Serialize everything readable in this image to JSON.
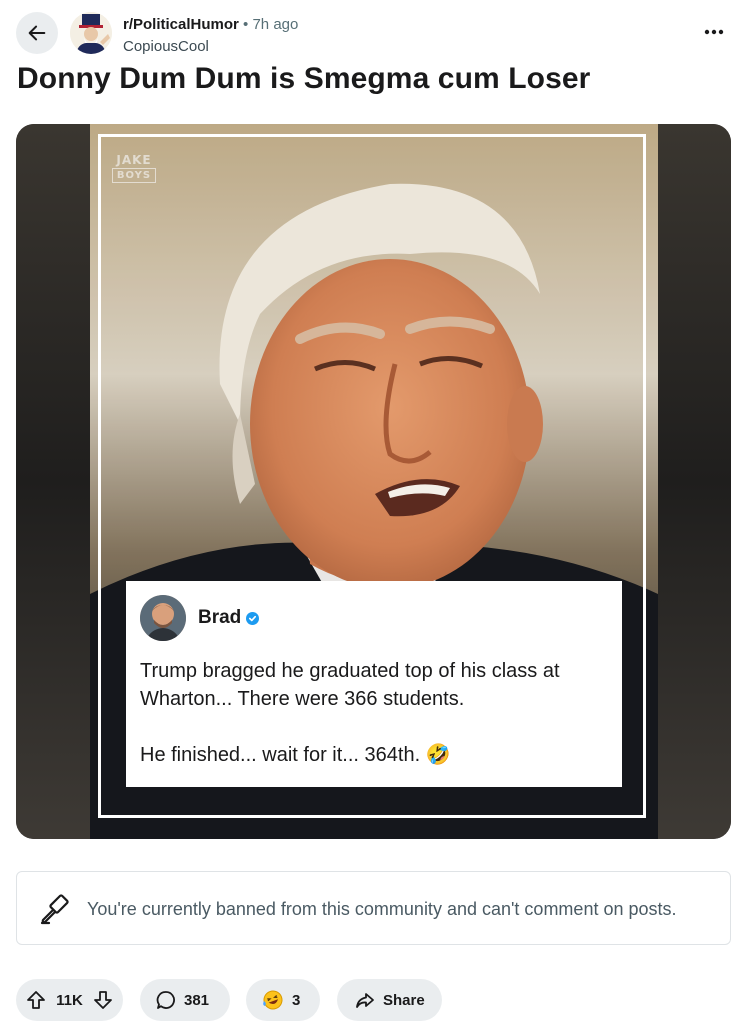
{
  "post": {
    "subreddit": "r/PoliticalHumor",
    "separator": "•",
    "time_ago": "7h ago",
    "author": "CopiousCool",
    "title": "Donny Dum Dum is Smegma cum Loser"
  },
  "image": {
    "watermark_line1": "JAKE",
    "watermark_line2": "BOYS",
    "tweet": {
      "name": "Brad",
      "line1": "Trump bragged he graduated top of his class at Wharton... There were 366 students.",
      "line2": "He finished... wait for it... 364th. 🤣"
    }
  },
  "banned_notice": "You're currently banned from this community and can't comment on posts.",
  "actions": {
    "votes": "11K",
    "comments": "381",
    "awards": "3",
    "share_label": "Share"
  },
  "icons": {
    "back": "arrow-left-icon",
    "more": "more-horizontal-icon",
    "banned": "gavel-icon",
    "upvote": "arrow-up-icon",
    "downvote": "arrow-down-icon",
    "comment": "speech-bubble-icon",
    "award": "laughing-emoji-icon",
    "share": "share-arrow-icon",
    "verified": "verified-badge-icon"
  },
  "colors": {
    "pill_background": "#eaedef",
    "verified_badge": "#1d9bf0",
    "text_primary": "#1a1a1b",
    "text_secondary": "#576f76"
  }
}
